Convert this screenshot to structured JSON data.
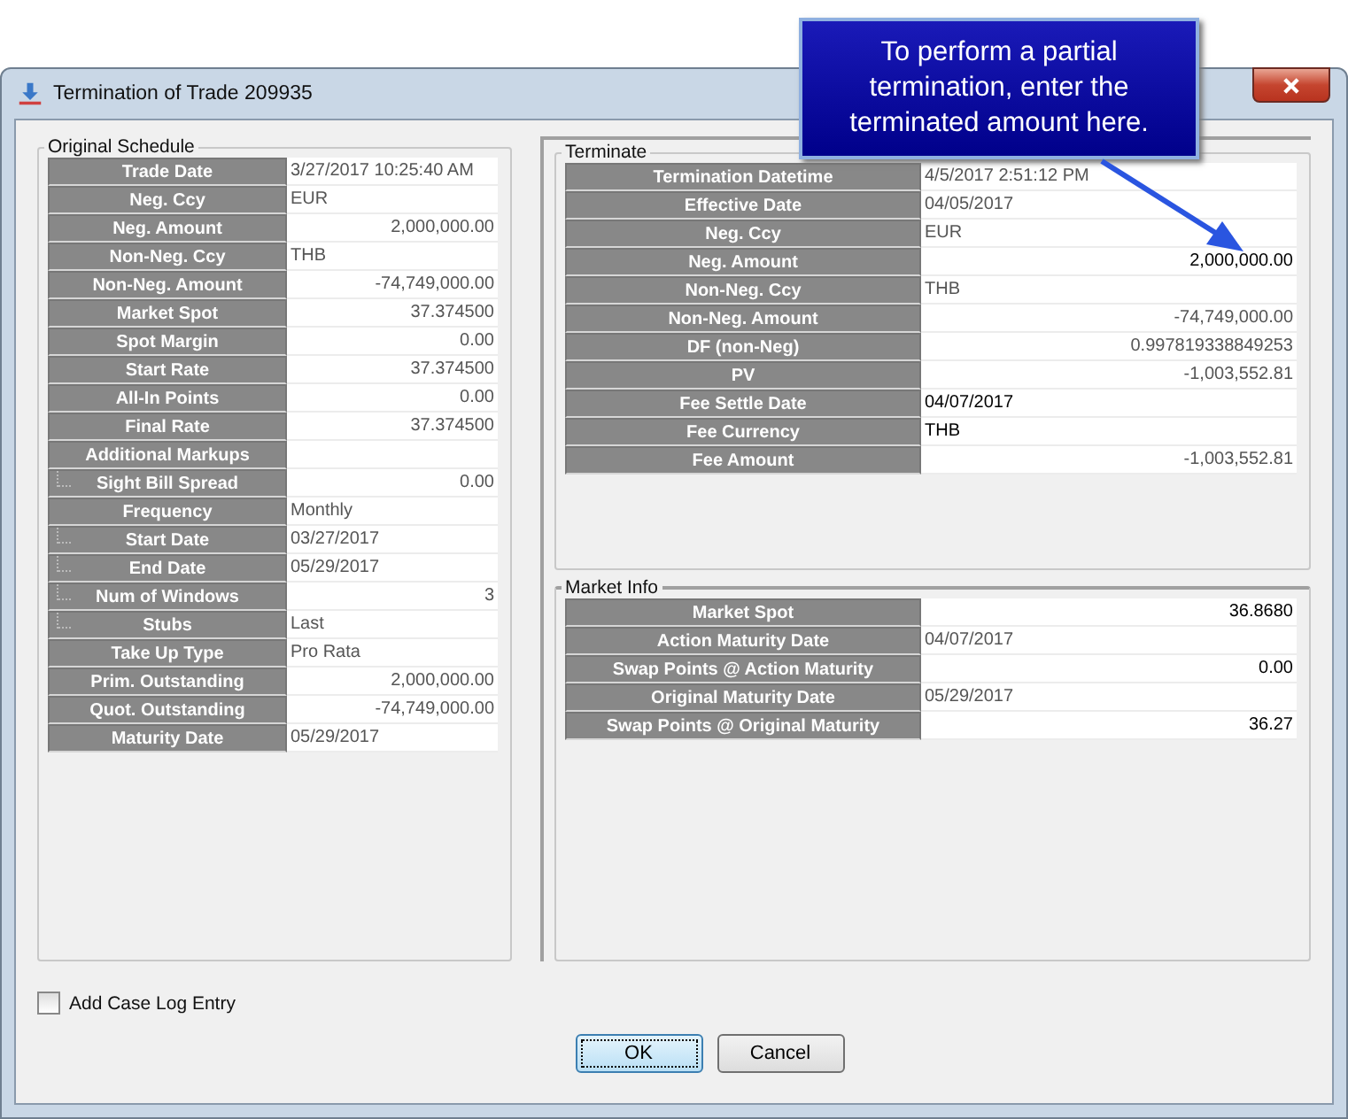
{
  "window": {
    "title": "Termination of Trade 209935"
  },
  "callout": {
    "text": "To perform a partial termination, enter the terminated amount here."
  },
  "original_schedule": {
    "title": "Original Schedule",
    "rows": [
      {
        "label": "Trade Date",
        "value": "3/27/2017 10:25:40 AM",
        "kind": "text",
        "editable": false
      },
      {
        "label": "Neg. Ccy",
        "value": "EUR",
        "kind": "text",
        "editable": false
      },
      {
        "label": "Neg. Amount",
        "value": "2,000,000.00",
        "kind": "number",
        "editable": false
      },
      {
        "label": "Non-Neg. Ccy",
        "value": "THB",
        "kind": "text",
        "editable": false
      },
      {
        "label": "Non-Neg. Amount",
        "value": "-74,749,000.00",
        "kind": "number",
        "editable": false
      },
      {
        "label": "Market Spot",
        "value": "37.374500",
        "kind": "number",
        "editable": false
      },
      {
        "label": "Spot Margin",
        "value": "0.00",
        "kind": "number",
        "editable": false
      },
      {
        "label": "Start Rate",
        "value": "37.374500",
        "kind": "number",
        "editable": false
      },
      {
        "label": "All-In Points",
        "value": "0.00",
        "kind": "number",
        "editable": false
      },
      {
        "label": "Final Rate",
        "value": "37.374500",
        "kind": "number",
        "editable": false
      },
      {
        "label": "Additional Markups",
        "children": [
          {
            "label": "Sight Bill Spread",
            "value": "0.00",
            "kind": "number",
            "editable": false
          }
        ]
      },
      {
        "label": "Frequency",
        "value": "Monthly",
        "kind": "text",
        "editable": false,
        "children": [
          {
            "label": "Start Date",
            "value": "03/27/2017",
            "kind": "text",
            "editable": false
          },
          {
            "label": "End Date",
            "value": "05/29/2017",
            "kind": "text",
            "editable": false
          },
          {
            "label": "Num of Windows",
            "value": "3",
            "kind": "number",
            "editable": false
          },
          {
            "label": "Stubs",
            "value": "Last",
            "kind": "text",
            "editable": false
          }
        ]
      },
      {
        "label": "Take Up Type",
        "value": "Pro Rata",
        "kind": "text",
        "editable": false
      },
      {
        "label": "Prim. Outstanding",
        "value": "2,000,000.00",
        "kind": "number",
        "editable": false
      },
      {
        "label": "Quot. Outstanding",
        "value": "-74,749,000.00",
        "kind": "number",
        "editable": false
      },
      {
        "label": "Maturity Date",
        "value": "05/29/2017",
        "kind": "text",
        "editable": false
      }
    ]
  },
  "terminate": {
    "title": "Terminate",
    "rows": [
      {
        "label": "Termination Datetime",
        "value": "4/5/2017 2:51:12 PM",
        "kind": "text",
        "editable": false
      },
      {
        "label": "Effective Date",
        "value": "04/05/2017",
        "kind": "text",
        "editable": false
      },
      {
        "label": "Neg. Ccy",
        "value": "EUR",
        "kind": "text",
        "editable": false
      },
      {
        "label": "Neg. Amount",
        "value": "2,000,000.00",
        "kind": "number",
        "editable": true
      },
      {
        "label": "Non-Neg. Ccy",
        "value": "THB",
        "kind": "text",
        "editable": false
      },
      {
        "label": "Non-Neg. Amount",
        "value": "-74,749,000.00",
        "kind": "number",
        "editable": false
      },
      {
        "label": "DF (non-Neg)",
        "value": "0.997819338849253",
        "kind": "number",
        "editable": false
      },
      {
        "label": "PV",
        "value": "-1,003,552.81",
        "kind": "number",
        "editable": false
      },
      {
        "label": "Fee Settle Date",
        "value": "04/07/2017",
        "kind": "text",
        "editable": true
      },
      {
        "label": "Fee Currency",
        "value": "THB",
        "kind": "text",
        "editable": true
      },
      {
        "label": "Fee Amount",
        "value": "-1,003,552.81",
        "kind": "number",
        "editable": false
      }
    ]
  },
  "market_info": {
    "title": "Market Info",
    "rows": [
      {
        "label": "Market Spot",
        "value": "36.8680",
        "kind": "number",
        "editable": true
      },
      {
        "label": "Action Maturity Date",
        "value": "04/07/2017",
        "kind": "text",
        "editable": false
      },
      {
        "label": "Swap Points @ Action Maturity",
        "value": "0.00",
        "kind": "number",
        "editable": true
      },
      {
        "label": "Original Maturity Date",
        "value": "05/29/2017",
        "kind": "text",
        "editable": false
      },
      {
        "label": "Swap Points @ Original Maturity",
        "value": "36.27",
        "kind": "number",
        "editable": true
      }
    ]
  },
  "case_log": {
    "label": "Add Case Log Entry",
    "checked": false
  },
  "buttons": [
    {
      "label": "OK",
      "default": true
    },
    {
      "label": "Cancel",
      "default": false
    }
  ]
}
